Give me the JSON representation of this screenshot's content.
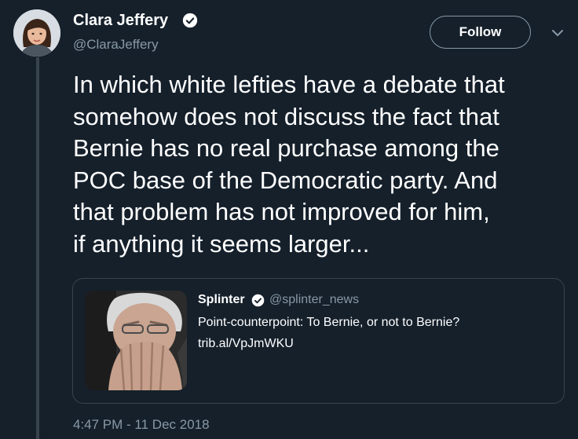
{
  "author": {
    "name": "Clara Jeffery",
    "handle": "@ClaraJeffery",
    "verified": true,
    "verified_color": "#ffffff"
  },
  "actions": {
    "follow_label": "Follow",
    "more_icon": "chevron-down-icon"
  },
  "tweet": {
    "lines": [
      "In which white lefties have a debate that",
      "somehow does not discuss the fact that",
      "Bernie has no real purchase among the",
      "POC base of the Democratic party. And",
      "that problem has not improved for him,",
      "if anything it seems larger..."
    ],
    "timestamp": "4:47 PM - 11 Dec 2018"
  },
  "quoted": {
    "name": "Splinter",
    "handle": "@splinter_news",
    "verified": true,
    "text": "Point-counterpoint: To Bernie, or not to Bernie?",
    "link": "trib.al/VpJmWKU"
  },
  "colors": {
    "background": "#15202b",
    "text": "#ffffff",
    "muted": "#8899a6",
    "border": "#38444d"
  }
}
